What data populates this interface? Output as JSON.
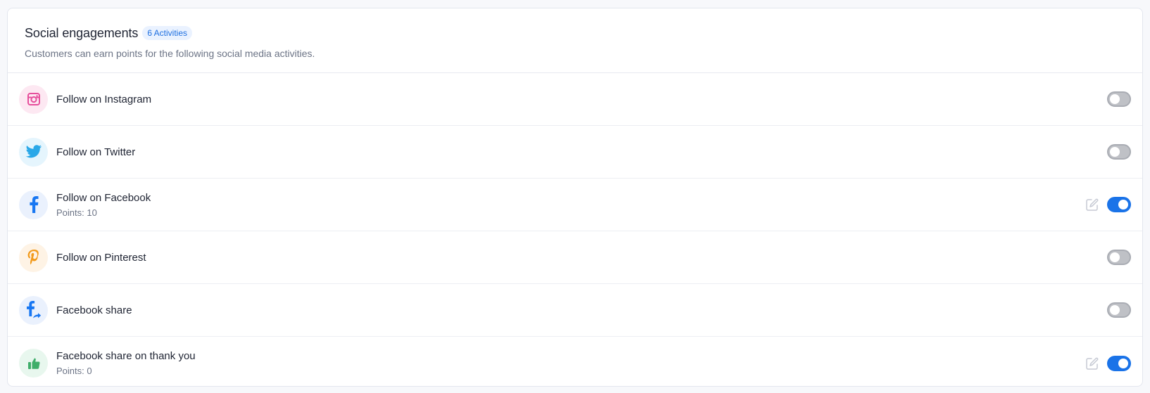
{
  "header": {
    "title": "Social engagements",
    "badge": "6 Activities",
    "subtitle": "Customers can earn points for the following social media activities."
  },
  "activities": [
    {
      "label": "Follow on Instagram",
      "points": "",
      "icon": "instagram-icon",
      "icon_color": "#e64f9c",
      "icon_bg": "#fde8f2",
      "enabled": false,
      "editable": false
    },
    {
      "label": "Follow on Twitter",
      "points": "",
      "icon": "twitter-icon",
      "icon_color": "#2aa8e8",
      "icon_bg": "#e5f5fd",
      "enabled": false,
      "editable": false
    },
    {
      "label": "Follow on Facebook",
      "points": "Points: 10",
      "icon": "facebook-icon",
      "icon_color": "#1877f2",
      "icon_bg": "#eaf1fd",
      "enabled": true,
      "editable": true
    },
    {
      "label": "Follow on Pinterest",
      "points": "",
      "icon": "pinterest-icon",
      "icon_color": "#f29a1a",
      "icon_bg": "#fef3e5",
      "enabled": false,
      "editable": false
    },
    {
      "label": "Facebook share",
      "points": "",
      "icon": "facebook-share-icon",
      "icon_color": "#1877f2",
      "icon_bg": "#eaf1fd",
      "enabled": false,
      "editable": false
    },
    {
      "label": "Facebook share on thank you",
      "points": "Points: 0",
      "icon": "thumbs-up-icon",
      "icon_color": "#3fae6a",
      "icon_bg": "#e8f7ee",
      "enabled": true,
      "editable": true
    }
  ],
  "colors": {
    "accent": "#1a73e8",
    "toggle_off": "#bfc1c6",
    "edit_icon": "#c5c9d3"
  }
}
